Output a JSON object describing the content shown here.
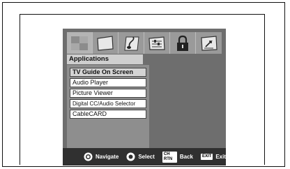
{
  "menu": {
    "title": "Applications",
    "items": [
      {
        "label": "TV Guide On Screen",
        "selected": true
      },
      {
        "label": "Audio Player"
      },
      {
        "label": "Picture Viewer"
      },
      {
        "label": "Digital CC/Audio Selector"
      },
      {
        "label": "CableCARD"
      }
    ]
  },
  "tabs": [
    {
      "icon": "applications-icon",
      "active": true
    },
    {
      "icon": "screen-icon"
    },
    {
      "icon": "music-note-icon"
    },
    {
      "icon": "settings-sliders-icon"
    },
    {
      "icon": "lock-icon"
    },
    {
      "icon": "setup-arrow-icon"
    }
  ],
  "nav": {
    "navigate": "Navigate",
    "select": "Select",
    "back_key": "CH RTN",
    "back": "Back",
    "exit_key": "EXIT",
    "exit": "Exit"
  }
}
